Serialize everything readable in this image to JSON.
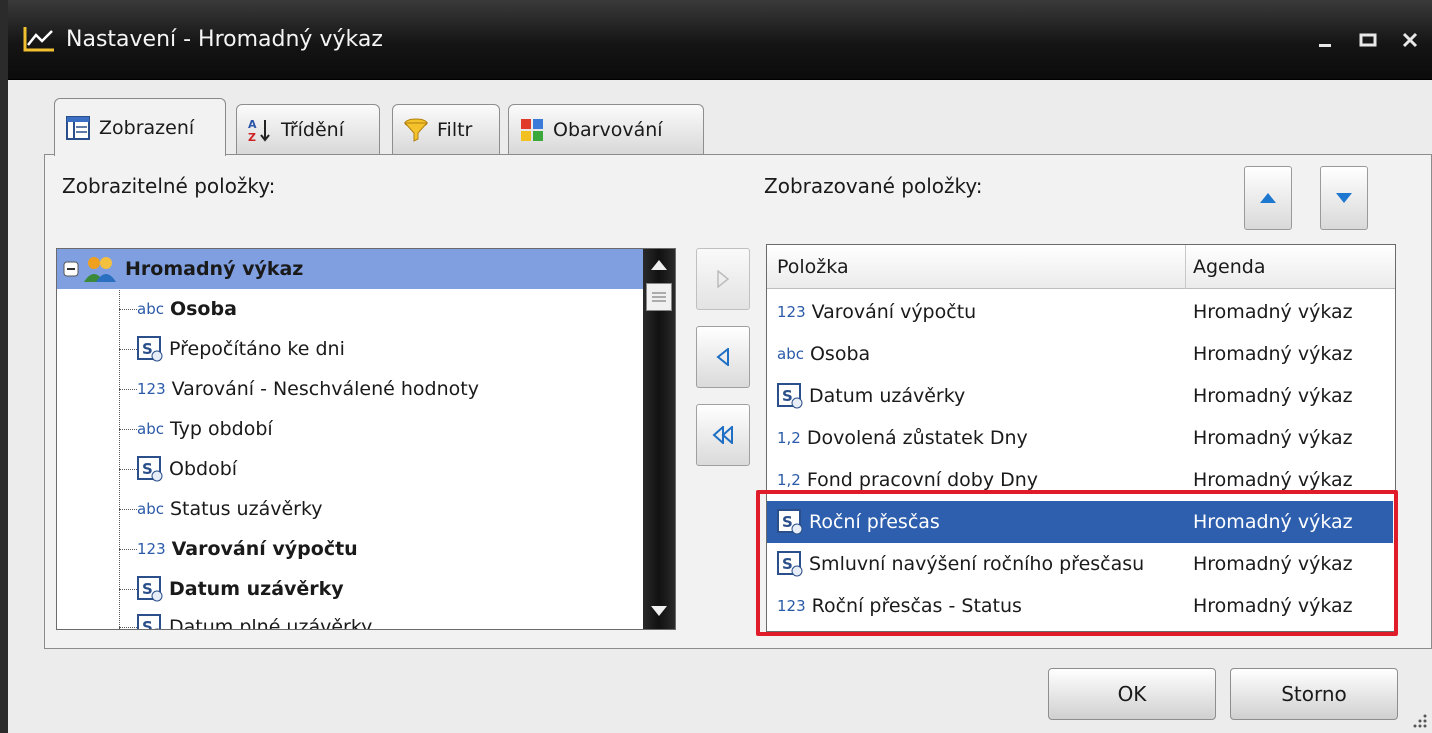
{
  "window": {
    "title": "Nastavení - Hromadný výkaz",
    "icon": "chart-icon"
  },
  "tabs": [
    {
      "label": "Zobrazení",
      "icon": "columns-icon",
      "active": true
    },
    {
      "label": "Třídění",
      "icon": "sort-az-icon",
      "active": false
    },
    {
      "label": "Filtr",
      "icon": "funnel-icon",
      "active": false
    },
    {
      "label": "Obarvování",
      "icon": "color-grid-icon",
      "active": false
    }
  ],
  "left": {
    "label": "Zobrazitelné položky:",
    "root": "Hromadný výkaz",
    "items": [
      {
        "type": "abc",
        "label": "Osoba",
        "bold": true
      },
      {
        "type": "calendar",
        "label": "Přepočítáno ke dni",
        "bold": false
      },
      {
        "type": "123",
        "label": "Varování - Neschválené hodnoty",
        "bold": false
      },
      {
        "type": "abc",
        "label": "Typ období",
        "bold": false
      },
      {
        "type": "calendar",
        "label": "Období",
        "bold": false
      },
      {
        "type": "abc",
        "label": "Status uzávěrky",
        "bold": false
      },
      {
        "type": "123",
        "label": "Varování výpočtu",
        "bold": true
      },
      {
        "type": "calendar",
        "label": "Datum uzávěrky",
        "bold": true
      },
      {
        "type": "calendar",
        "label": "Datum plné uzávěrky",
        "bold": false
      }
    ]
  },
  "right": {
    "label": "Zobrazované položky:",
    "columns": [
      "Položka",
      "Agenda"
    ],
    "rows": [
      {
        "type": "123",
        "item": "Varování výpočtu",
        "agenda": "Hromadný výkaz",
        "selected": false
      },
      {
        "type": "abc",
        "item": "Osoba",
        "agenda": "Hromadný výkaz",
        "selected": false
      },
      {
        "type": "calendar",
        "item": "Datum uzávěrky",
        "agenda": "Hromadný výkaz",
        "selected": false
      },
      {
        "type": "1,2",
        "item": "Dovolená zůstatek Dny",
        "agenda": "Hromadný výkaz",
        "selected": false
      },
      {
        "type": "1,2",
        "item": "Fond pracovní doby Dny",
        "agenda": "Hromadný výkaz",
        "selected": false
      },
      {
        "type": "calendar",
        "item": "Roční přesčas",
        "agenda": "Hromadný výkaz",
        "selected": true
      },
      {
        "type": "calendar",
        "item": "Smluvní navýšení ročního přesčasu",
        "agenda": "Hromadný výkaz",
        "selected": false
      },
      {
        "type": "123",
        "item": "Roční přesčas - Status",
        "agenda": "Hromadný výkaz",
        "selected": false
      }
    ]
  },
  "type_labels": {
    "abc": "abc",
    "123": "123",
    "1,2": "1,2",
    "calendar_letter": "S"
  },
  "buttons": {
    "ok": "OK",
    "cancel": "Storno"
  },
  "colors": {
    "selection": "#2e5fae",
    "highlight": "#e01b2a",
    "titlebar": "#151515"
  }
}
